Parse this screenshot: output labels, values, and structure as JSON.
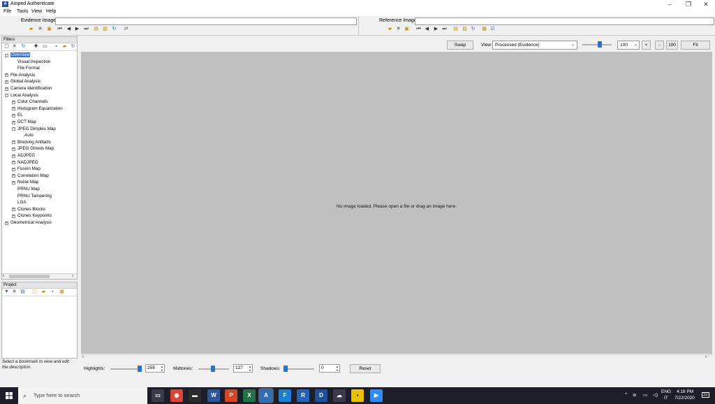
{
  "window": {
    "title": "Amped Authenticate",
    "app_icon": "amped-logo-icon"
  },
  "menu": [
    "File",
    "Tools",
    "View",
    "Help"
  ],
  "evidence": {
    "label": "Evidence Image:",
    "value": ""
  },
  "reference": {
    "label": "Reference Image:",
    "value": ""
  },
  "filters": {
    "header": "Filters",
    "tree": [
      {
        "label": "Overview",
        "level": 0,
        "expander": "-",
        "selected": true
      },
      {
        "label": "Visual Inspection",
        "level": 1,
        "expander": ""
      },
      {
        "label": "File Format",
        "level": 1,
        "expander": ""
      },
      {
        "label": "File Analysis",
        "level": 0,
        "expander": "+"
      },
      {
        "label": "Global Analysis",
        "level": 0,
        "expander": "+"
      },
      {
        "label": "Camera Identification",
        "level": 0,
        "expander": "+"
      },
      {
        "label": "Local Analysis",
        "level": 0,
        "expander": "-"
      },
      {
        "label": "Color Channels",
        "level": 1,
        "expander": "+"
      },
      {
        "label": "Histogram Equalization",
        "level": 1,
        "expander": "+"
      },
      {
        "label": "EL",
        "level": 1,
        "expander": "+"
      },
      {
        "label": "DCT Map",
        "level": 1,
        "expander": "+"
      },
      {
        "label": "JPEG Dimples Map",
        "level": 1,
        "expander": "-"
      },
      {
        "label": "Auto",
        "level": 2,
        "expander": ""
      },
      {
        "label": "Blocking Artifacts",
        "level": 1,
        "expander": "+"
      },
      {
        "label": "JPEG Ghosts Map",
        "level": 1,
        "expander": "+"
      },
      {
        "label": "ADJPEG",
        "level": 1,
        "expander": "+"
      },
      {
        "label": "NADJPEG",
        "level": 1,
        "expander": "+"
      },
      {
        "label": "Fusion Map",
        "level": 1,
        "expander": "+"
      },
      {
        "label": "Correlation Map",
        "level": 1,
        "expander": "+"
      },
      {
        "label": "Noise Map",
        "level": 1,
        "expander": "+"
      },
      {
        "label": "PRNU Map",
        "level": 1,
        "expander": ""
      },
      {
        "label": "PRNU Tampering",
        "level": 1,
        "expander": ""
      },
      {
        "label": "LGA",
        "level": 1,
        "expander": ""
      },
      {
        "label": "Clones Blocks",
        "level": 1,
        "expander": "+"
      },
      {
        "label": "Clones Keypoints",
        "level": 1,
        "expander": "+"
      },
      {
        "label": "Geometrical Analysis",
        "level": 0,
        "expander": "+"
      }
    ]
  },
  "project": {
    "header": "Project",
    "hint": "Select a bookmark to view and edit the description."
  },
  "view_toolbar": {
    "swap_label": "Swap",
    "view_label": "View:",
    "view_value": "Processed (Evidence)",
    "zoom_value": "100",
    "zoom_in_label": "+",
    "zoom_out_label": "-",
    "zoom_100_label": "100",
    "fit_label": "Fit"
  },
  "canvas": {
    "message": "No image loaded. Please open a file or drag an image here."
  },
  "levels": {
    "highlights_label": "Highlights:",
    "highlights_value": "255",
    "midtones_label": "Midtones:",
    "midtones_value": "127",
    "shadows_label": "Shadows:",
    "shadows_value": "0",
    "reset_label": "Reset"
  },
  "taskbar": {
    "search_placeholder": "Type here to search",
    "lang": "ENG",
    "lang_sub": "IT",
    "time": "4:18 PM",
    "date": "7/22/2020",
    "notif_count": "22"
  }
}
